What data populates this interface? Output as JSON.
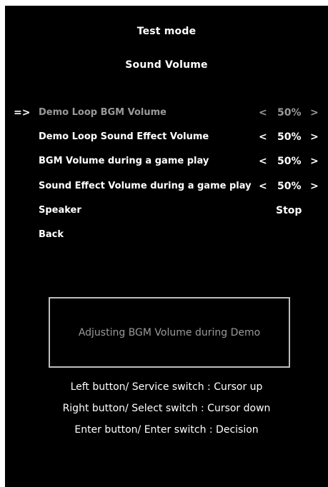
{
  "header": {
    "title": "Test mode",
    "subtitle": "Sound Volume"
  },
  "cursor": "=>",
  "menu": {
    "items": [
      {
        "label": "Demo Loop BGM Volume",
        "left_arrow": "<",
        "value": "50%",
        "right_arrow": ">"
      },
      {
        "label": "Demo Loop Sound Effect Volume",
        "left_arrow": "<",
        "value": "50%",
        "right_arrow": ">"
      },
      {
        "label": "BGM Volume during a game play",
        "left_arrow": "<",
        "value": "50%",
        "right_arrow": ">"
      },
      {
        "label": "Sound Effect Volume during a game play",
        "left_arrow": "<",
        "value": "50%",
        "right_arrow": ">"
      },
      {
        "label": "Speaker",
        "value": "Stop"
      },
      {
        "label": "Back"
      }
    ],
    "selected_index": 0
  },
  "description": "Adjusting BGM Volume during Demo",
  "help": {
    "lines": [
      "Left button/ Service switch : Cursor up",
      "Right button/ Select switch : Cursor down",
      "Enter button/ Enter switch : Decision"
    ]
  },
  "colors": {
    "background": "#000000",
    "text": "#ffffff",
    "selected_text": "#999999",
    "description_text": "#9a9a9a",
    "box_border": "#bdbdbd"
  }
}
